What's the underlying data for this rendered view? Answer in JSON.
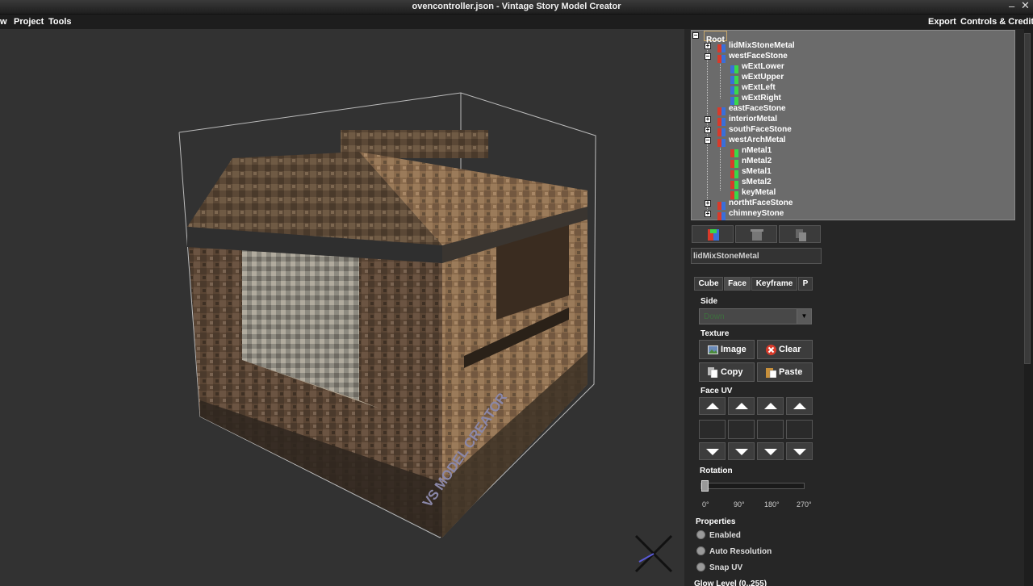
{
  "window": {
    "title": "ovencontroller.json - Vintage Story Model Creator",
    "minimize": "–",
    "close": "✕"
  },
  "menu": {
    "view": "w",
    "project": "Project",
    "tools": "Tools",
    "export": "Export",
    "controls": "Controls & Credits"
  },
  "viewport": {
    "watermark": "VS MODEL CREATOR"
  },
  "tree": {
    "root": "Root",
    "nodes": [
      {
        "label": "lidMixStoneMetal",
        "toggle": "+"
      },
      {
        "label": "westFaceStone",
        "toggle": "−"
      },
      {
        "label": "wExtLower",
        "toggle": ""
      },
      {
        "label": "wExtUpper",
        "toggle": ""
      },
      {
        "label": "wExtLeft",
        "toggle": ""
      },
      {
        "label": "wExtRight",
        "toggle": ""
      },
      {
        "label": "eastFaceStone",
        "toggle": ""
      },
      {
        "label": "interiorMetal",
        "toggle": "+"
      },
      {
        "label": "southFaceStone",
        "toggle": "+"
      },
      {
        "label": "westArchMetal",
        "toggle": "−"
      },
      {
        "label": "nMetal1",
        "toggle": ""
      },
      {
        "label": "nMetal2",
        "toggle": ""
      },
      {
        "label": "sMetal1",
        "toggle": ""
      },
      {
        "label": "sMetal2",
        "toggle": ""
      },
      {
        "label": "keyMetal",
        "toggle": ""
      },
      {
        "label": "northtFaceStone",
        "toggle": "+"
      },
      {
        "label": "chimneyStone",
        "toggle": "+"
      }
    ]
  },
  "selected_name": "lidMixStoneMetal",
  "tabs": {
    "cube": "Cube",
    "face": "Face",
    "keyframe": "Keyframe",
    "p": "P"
  },
  "face": {
    "side_label": "Side",
    "side_value": "Down",
    "texture_label": "Texture",
    "image": "Image",
    "clear": "Clear",
    "copy": "Copy",
    "paste": "Paste",
    "uv_label": "Face UV",
    "rotation_label": "Rotation",
    "rotation_ticks": [
      "0°",
      "90°",
      "180°",
      "270°"
    ],
    "rotation_value": 0,
    "properties_label": "Properties",
    "enabled": "Enabled",
    "auto_resolution": "Auto Resolution",
    "snap_uv": "Snap UV",
    "glow_label": "Glow Level (0..255)"
  },
  "colors": {
    "accent_red": "#d83a2a",
    "tree_bg": "#6b6b6b",
    "panel_bg": "#262626"
  }
}
